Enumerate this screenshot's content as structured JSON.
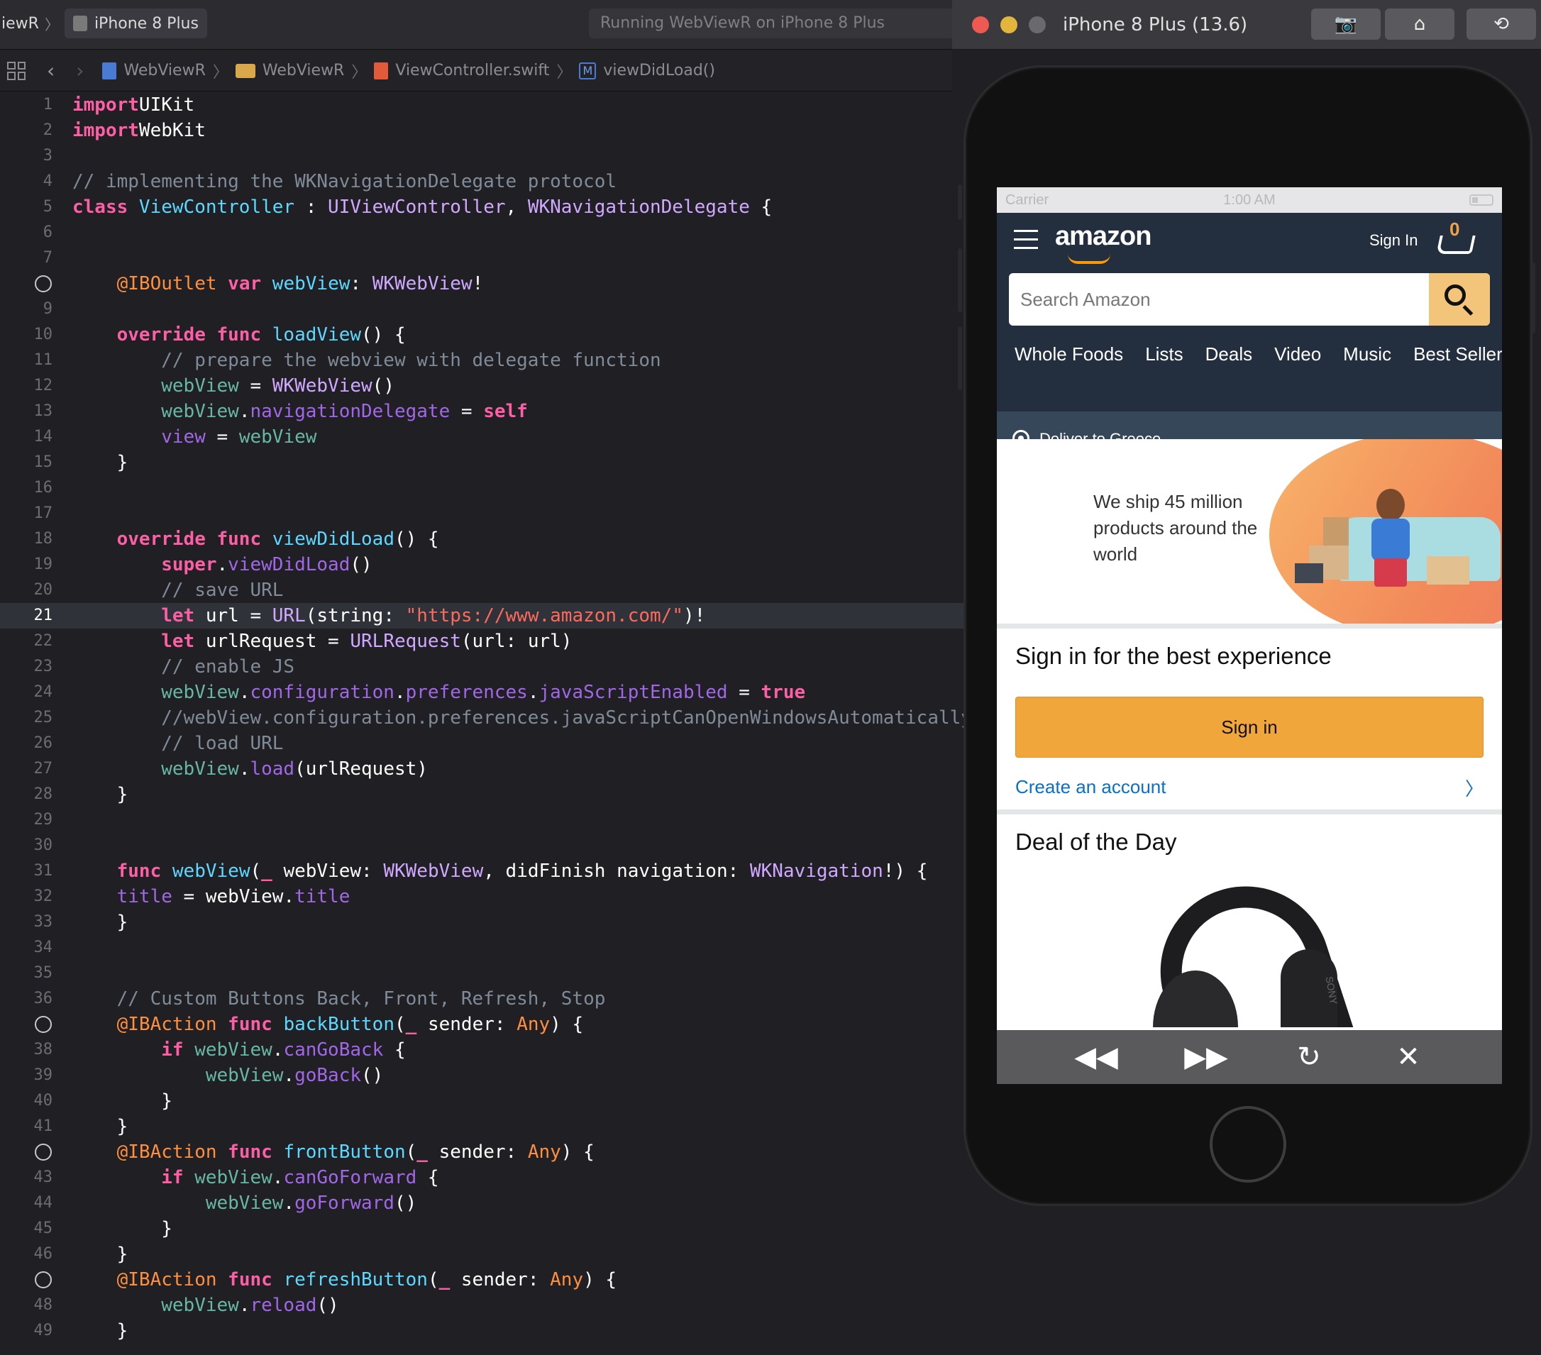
{
  "toolbar": {
    "scheme_app": "iewR",
    "scheme_device": "iPhone 8 Plus",
    "status_text": "Running WebViewR on iPhone 8 Plus"
  },
  "jumpbar": {
    "crumbs": [
      "WebViewR",
      "WebViewR",
      "ViewController.swift",
      "viewDidLoad()"
    ]
  },
  "editor": {
    "current_line": 21,
    "breakpoint_lines": [
      8,
      37,
      42,
      47
    ],
    "lines": [
      {
        "n": 1,
        "code": [
          [
            "kw",
            "import"
          ],
          [
            "",
            "UIKit"
          ]
        ]
      },
      {
        "n": 2,
        "code": [
          [
            "kw",
            "import"
          ],
          [
            "",
            "WebKit"
          ]
        ]
      },
      {
        "n": 3,
        "code": []
      },
      {
        "n": 4,
        "code": [
          [
            "cm",
            "// implementing the WKNavigationDelegate protocol"
          ]
        ]
      },
      {
        "n": 5,
        "code": [
          [
            "kw",
            "class "
          ],
          [
            "dc",
            "ViewController"
          ],
          [
            "",
            " : "
          ],
          [
            "ty",
            "UIViewController"
          ],
          [
            "",
            ", "
          ],
          [
            "ty",
            "WKNavigationDelegate"
          ],
          [
            "",
            " {"
          ]
        ]
      },
      {
        "n": 6,
        "code": []
      },
      {
        "n": 7,
        "code": []
      },
      {
        "n": 8,
        "code": [
          [
            "",
            "    "
          ],
          [
            "at",
            "@IBOutlet"
          ],
          [
            "kw",
            " var "
          ],
          [
            "dc",
            "webView"
          ],
          [
            "",
            ": "
          ],
          [
            "ty",
            "WKWebView"
          ],
          [
            "",
            "!"
          ]
        ]
      },
      {
        "n": 9,
        "code": []
      },
      {
        "n": 10,
        "code": [
          [
            "",
            "    "
          ],
          [
            "kw",
            "override func "
          ],
          [
            "dc",
            "loadView"
          ],
          [
            "",
            "() {"
          ]
        ]
      },
      {
        "n": 11,
        "code": [
          [
            "",
            "        "
          ],
          [
            "cm",
            "// prepare the webview with delegate function"
          ]
        ]
      },
      {
        "n": 12,
        "code": [
          [
            "",
            "        "
          ],
          [
            "fn",
            "webView"
          ],
          [
            "",
            " = "
          ],
          [
            "ty",
            "WKWebView"
          ],
          [
            "",
            "()"
          ]
        ]
      },
      {
        "n": 13,
        "code": [
          [
            "",
            "        "
          ],
          [
            "fn",
            "webView"
          ],
          [
            "",
            "."
          ],
          [
            "pr",
            "navigationDelegate"
          ],
          [
            "",
            " = "
          ],
          [
            "kw",
            "self"
          ]
        ]
      },
      {
        "n": 14,
        "code": [
          [
            "",
            "        "
          ],
          [
            "pr",
            "view"
          ],
          [
            "",
            " = "
          ],
          [
            "fn",
            "webView"
          ]
        ]
      },
      {
        "n": 15,
        "code": [
          [
            "",
            "    }"
          ]
        ]
      },
      {
        "n": 16,
        "code": []
      },
      {
        "n": 17,
        "code": []
      },
      {
        "n": 18,
        "code": [
          [
            "",
            "    "
          ],
          [
            "kw",
            "override func "
          ],
          [
            "dc",
            "viewDidLoad"
          ],
          [
            "",
            "() {"
          ]
        ]
      },
      {
        "n": 19,
        "code": [
          [
            "",
            "        "
          ],
          [
            "kw",
            "super"
          ],
          [
            "",
            "."
          ],
          [
            "pr",
            "viewDidLoad"
          ],
          [
            "",
            "()"
          ]
        ]
      },
      {
        "n": 20,
        "code": [
          [
            "",
            "        "
          ],
          [
            "cm",
            "// save URL"
          ]
        ]
      },
      {
        "n": 21,
        "code": [
          [
            "",
            "        "
          ],
          [
            "kw",
            "let"
          ],
          [
            "",
            " url = "
          ],
          [
            "ty",
            "URL"
          ],
          [
            "",
            "(string: "
          ],
          [
            "str",
            "\"https://www.amazon.com/\""
          ],
          [
            "",
            ")!"
          ]
        ]
      },
      {
        "n": 22,
        "code": [
          [
            "",
            "        "
          ],
          [
            "kw",
            "let"
          ],
          [
            "",
            " urlRequest = "
          ],
          [
            "ty",
            "URLRequest"
          ],
          [
            "",
            "(url: url)"
          ]
        ]
      },
      {
        "n": 23,
        "code": [
          [
            "",
            "        "
          ],
          [
            "cm",
            "// enable JS"
          ]
        ]
      },
      {
        "n": 24,
        "code": [
          [
            "",
            "        "
          ],
          [
            "fn",
            "webView"
          ],
          [
            "",
            "."
          ],
          [
            "pr",
            "configuration"
          ],
          [
            "",
            "."
          ],
          [
            "pr",
            "preferences"
          ],
          [
            "",
            "."
          ],
          [
            "pr",
            "javaScriptEnabled"
          ],
          [
            "",
            " = "
          ],
          [
            "kw",
            "true"
          ]
        ]
      },
      {
        "n": 25,
        "code": [
          [
            "",
            "        "
          ],
          [
            "cm",
            "//webView.configuration.preferences.javaScriptCanOpenWindowsAutomatically"
          ]
        ]
      },
      {
        "n": 26,
        "code": [
          [
            "",
            "        "
          ],
          [
            "cm",
            "// load URL"
          ]
        ]
      },
      {
        "n": 27,
        "code": [
          [
            "",
            "        "
          ],
          [
            "fn",
            "webView"
          ],
          [
            "",
            "."
          ],
          [
            "pr",
            "load"
          ],
          [
            "",
            "(urlRequest)"
          ]
        ]
      },
      {
        "n": 28,
        "code": [
          [
            "",
            "    }"
          ]
        ]
      },
      {
        "n": 29,
        "code": []
      },
      {
        "n": 30,
        "code": []
      },
      {
        "n": 31,
        "code": [
          [
            "",
            "    "
          ],
          [
            "kw",
            "func "
          ],
          [
            "dc",
            "webView"
          ],
          [
            "",
            "("
          ],
          [
            "kw",
            "_"
          ],
          [
            "",
            " webView: "
          ],
          [
            "ty",
            "WKWebView"
          ],
          [
            "",
            ", didFinish navigation: "
          ],
          [
            "ty",
            "WKNavigation"
          ],
          [
            "",
            "!) {"
          ]
        ]
      },
      {
        "n": 32,
        "code": [
          [
            "",
            "    "
          ],
          [
            "pr",
            "title"
          ],
          [
            "",
            " = webView."
          ],
          [
            "pr",
            "title"
          ]
        ]
      },
      {
        "n": 33,
        "code": [
          [
            "",
            "    }"
          ]
        ]
      },
      {
        "n": 34,
        "code": []
      },
      {
        "n": 35,
        "code": []
      },
      {
        "n": 36,
        "code": [
          [
            "",
            "    "
          ],
          [
            "cm",
            "// Custom Buttons Back, Front, Refresh, Stop"
          ]
        ]
      },
      {
        "n": 37,
        "code": [
          [
            "",
            "    "
          ],
          [
            "at",
            "@IBAction"
          ],
          [
            "kw",
            " func "
          ],
          [
            "dc",
            "backButton"
          ],
          [
            "",
            "("
          ],
          [
            "kw",
            "_"
          ],
          [
            "",
            " sender: "
          ],
          [
            "at",
            "Any"
          ],
          [
            "",
            ") {"
          ]
        ]
      },
      {
        "n": 38,
        "code": [
          [
            "",
            "        "
          ],
          [
            "kw",
            "if "
          ],
          [
            "fn",
            "webView"
          ],
          [
            "",
            "."
          ],
          [
            "pr",
            "canGoBack"
          ],
          [
            "",
            " {"
          ]
        ]
      },
      {
        "n": 39,
        "code": [
          [
            "",
            "            "
          ],
          [
            "fn",
            "webView"
          ],
          [
            "",
            "."
          ],
          [
            "pr",
            "goBack"
          ],
          [
            "",
            "()"
          ]
        ]
      },
      {
        "n": 40,
        "code": [
          [
            "",
            "        }"
          ]
        ]
      },
      {
        "n": 41,
        "code": [
          [
            "",
            "    }"
          ]
        ]
      },
      {
        "n": 42,
        "code": [
          [
            "",
            "    "
          ],
          [
            "at",
            "@IBAction"
          ],
          [
            "kw",
            " func "
          ],
          [
            "dc",
            "frontButton"
          ],
          [
            "",
            "("
          ],
          [
            "kw",
            "_"
          ],
          [
            "",
            " sender: "
          ],
          [
            "at",
            "Any"
          ],
          [
            "",
            ") {"
          ]
        ]
      },
      {
        "n": 43,
        "code": [
          [
            "",
            "        "
          ],
          [
            "kw",
            "if "
          ],
          [
            "fn",
            "webView"
          ],
          [
            "",
            "."
          ],
          [
            "pr",
            "canGoForward"
          ],
          [
            "",
            " {"
          ]
        ]
      },
      {
        "n": 44,
        "code": [
          [
            "",
            "            "
          ],
          [
            "fn",
            "webView"
          ],
          [
            "",
            "."
          ],
          [
            "pr",
            "goForward"
          ],
          [
            "",
            "()"
          ]
        ]
      },
      {
        "n": 45,
        "code": [
          [
            "",
            "        }"
          ]
        ]
      },
      {
        "n": 46,
        "code": [
          [
            "",
            "    }"
          ]
        ]
      },
      {
        "n": 47,
        "code": [
          [
            "",
            "    "
          ],
          [
            "at",
            "@IBAction"
          ],
          [
            "kw",
            " func "
          ],
          [
            "dc",
            "refreshButton"
          ],
          [
            "",
            "("
          ],
          [
            "kw",
            "_"
          ],
          [
            "",
            " sender: "
          ],
          [
            "at",
            "Any"
          ],
          [
            "",
            ") {"
          ]
        ]
      },
      {
        "n": 48,
        "code": [
          [
            "",
            "        "
          ],
          [
            "fn",
            "webView"
          ],
          [
            "",
            "."
          ],
          [
            "pr",
            "reload"
          ],
          [
            "",
            "()"
          ]
        ]
      },
      {
        "n": 49,
        "code": [
          [
            "",
            "    }"
          ]
        ]
      }
    ]
  },
  "simulator": {
    "title": "iPhone 8 Plus (13.6)",
    "buttons": [
      "camera-icon",
      "home-icon",
      "rotate-icon"
    ],
    "status_bar": {
      "carrier": "Carrier",
      "time": "1:00 AM"
    },
    "amazon": {
      "logo": "amazon",
      "sign_in": "Sign In",
      "cart_count": "0",
      "search_placeholder": "Search Amazon",
      "nav_links": [
        "Whole Foods",
        "Lists",
        "Deals",
        "Video",
        "Music",
        "Best Sellers"
      ],
      "deliver": "Deliver to Greece",
      "hero_text": "We ship 45 million products around the world",
      "signin_card_title": "Sign in for the best experience",
      "signin_button": "Sign in",
      "create_account": "Create an account",
      "deal_title": "Deal of the Day",
      "deal_brand": "SONY"
    },
    "web_toolbar": [
      "rewind-icon",
      "fast-forward-icon",
      "refresh-icon",
      "close-icon"
    ]
  }
}
